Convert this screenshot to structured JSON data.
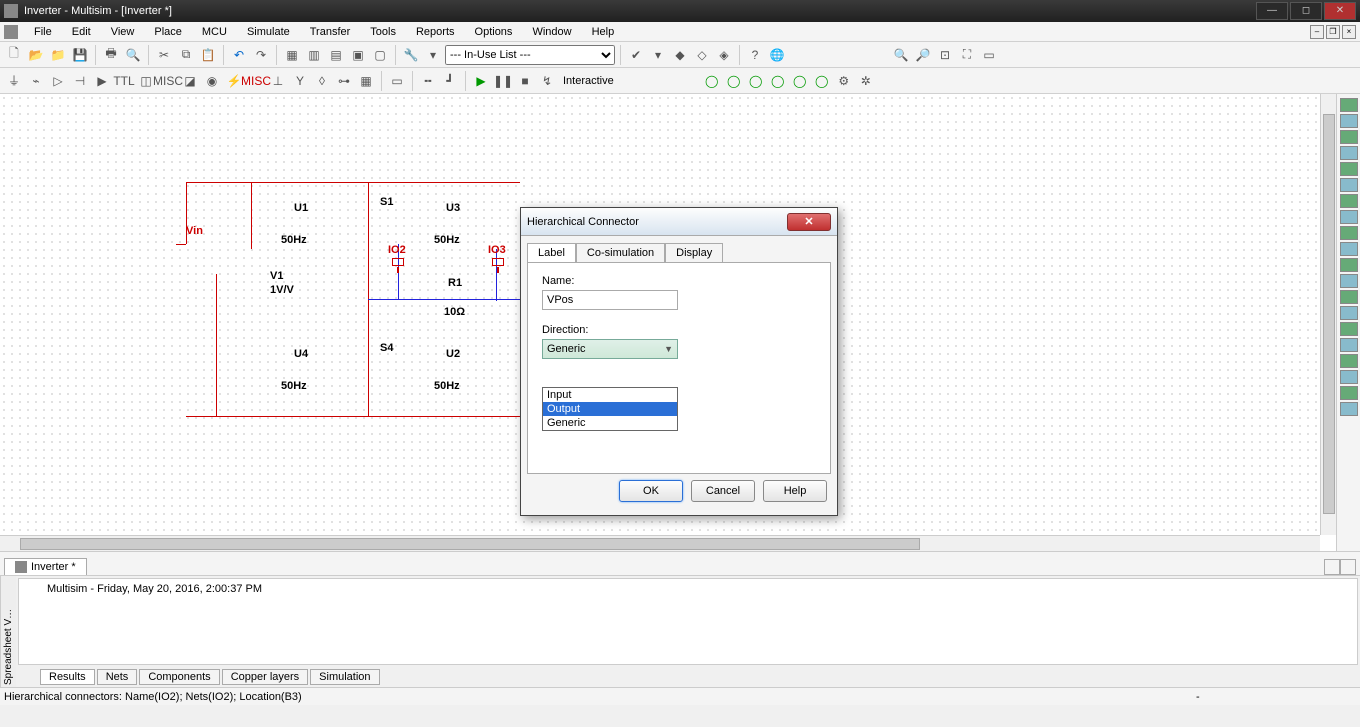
{
  "window": {
    "title": "Inverter - Multisim - [Inverter *]"
  },
  "menus": [
    "File",
    "Edit",
    "View",
    "Place",
    "MCU",
    "Simulate",
    "Transfer",
    "Tools",
    "Reports",
    "Options",
    "Window",
    "Help"
  ],
  "toolbar1": {
    "inuse_label": "--- In-Use List ---"
  },
  "toolbar2": {
    "mode_label": "Interactive"
  },
  "doc_tab": "Inverter *",
  "schematic": {
    "vin": "Vin",
    "v1": "V1",
    "v1_sub": "1V/V",
    "u1": "U1",
    "u1_sub": "50Hz",
    "u3": "U3",
    "u3_sub": "50Hz",
    "u4": "U4",
    "u4_sub": "50Hz",
    "u2": "U2",
    "u2_sub": "50Hz",
    "s1": "S1",
    "s4": "S4",
    "r1": "R1",
    "r1_sub": "10Ω",
    "io2": "IO2",
    "io3": "IO3"
  },
  "dialog": {
    "title": "Hierarchical Connector",
    "tabs": [
      "Label",
      "Co-simulation",
      "Display"
    ],
    "name_label": "Name:",
    "name_value": "VPos",
    "direction_label": "Direction:",
    "direction_value": "Generic",
    "options": [
      "Input",
      "Output",
      "Generic"
    ],
    "selected_option": "Output",
    "ok": "OK",
    "cancel": "Cancel",
    "help": "Help"
  },
  "log": {
    "text": "Multisim  -  Friday, May 20, 2016, 2:00:37 PM",
    "vtab": "Spreadsheet V…",
    "tabs": [
      "Results",
      "Nets",
      "Components",
      "Copper layers",
      "Simulation"
    ]
  },
  "status": {
    "text": "Hierarchical connectors: Name(IO2); Nets(IO2); Location(B3)",
    "dash": "-"
  }
}
